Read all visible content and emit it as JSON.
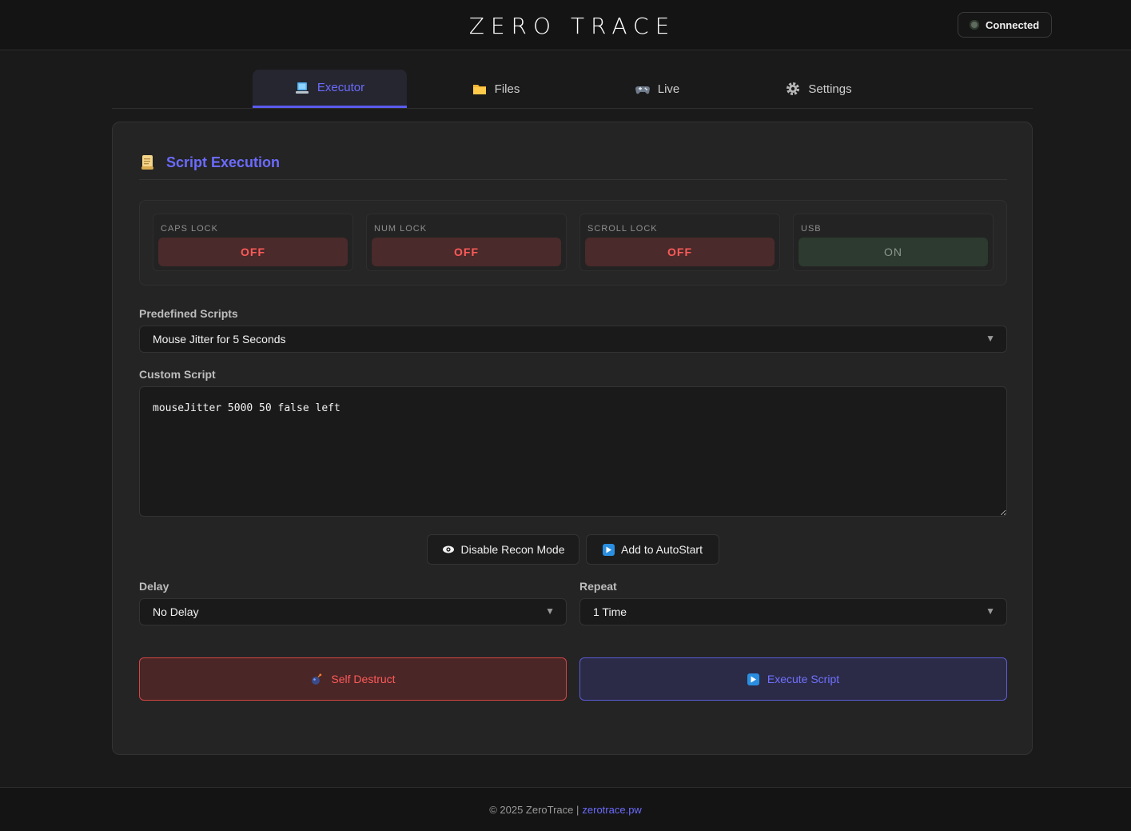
{
  "header": {
    "logo": "ZERO TRACE",
    "status": "Connected"
  },
  "tabs": [
    {
      "label": "Executor",
      "icon": "laptop-icon",
      "active": true
    },
    {
      "label": "Files",
      "icon": "folder-icon",
      "active": false
    },
    {
      "label": "Live",
      "icon": "gamepad-icon",
      "active": false
    },
    {
      "label": "Settings",
      "icon": "gear-icon",
      "active": false
    }
  ],
  "card": {
    "title": "Script Execution",
    "icon": "scroll-icon"
  },
  "locks": [
    {
      "label": "CAPS LOCK",
      "state": "OFF"
    },
    {
      "label": "NUM LOCK",
      "state": "OFF"
    },
    {
      "label": "SCROLL LOCK",
      "state": "OFF"
    },
    {
      "label": "USB",
      "state": "ON"
    }
  ],
  "predefined": {
    "label": "Predefined Scripts",
    "value": "Mouse Jitter for 5 Seconds"
  },
  "custom": {
    "label": "Custom Script",
    "value": "mouseJitter 5000 50 false left"
  },
  "actions": {
    "recon": "Disable Recon Mode",
    "autostart": "Add to AutoStart"
  },
  "delay": {
    "label": "Delay",
    "value": "No Delay"
  },
  "repeat": {
    "label": "Repeat",
    "value": "1 Time"
  },
  "buttons": {
    "self_destruct": "Self Destruct",
    "execute": "Execute Script"
  },
  "footer": {
    "copyright": "© 2025 ZeroTrace |",
    "link": "zerotrace.pw"
  },
  "colors": {
    "accent": "#6b6bff",
    "danger": "#ff5a5a",
    "background": "#1a1a1a"
  }
}
